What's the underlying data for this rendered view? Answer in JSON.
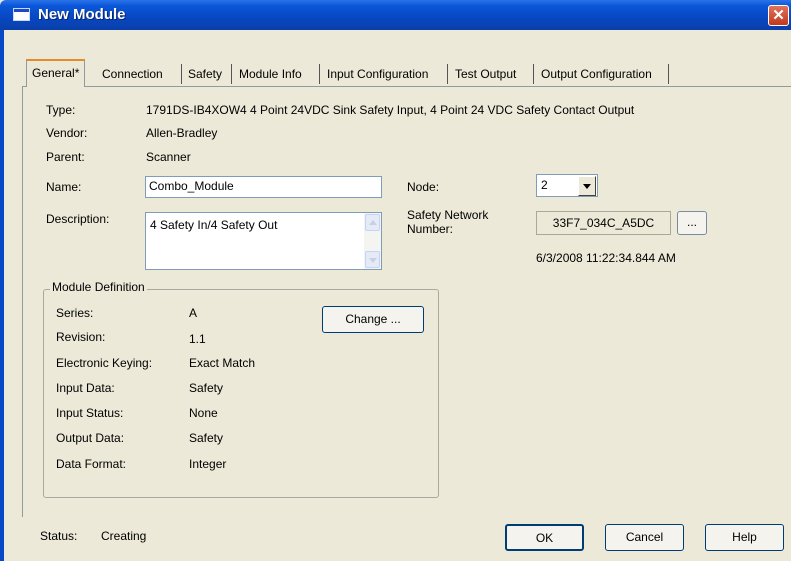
{
  "window": {
    "title": "New Module",
    "close_glyph": "✕"
  },
  "tabs": [
    {
      "label": "General*",
      "active": true
    },
    {
      "label": "Connection"
    },
    {
      "label": "Safety"
    },
    {
      "label": "Module Info"
    },
    {
      "label": "Input Configuration"
    },
    {
      "label": "Test Output"
    },
    {
      "label": "Output Configuration"
    }
  ],
  "general": {
    "type_label": "Type:",
    "type_value": "1791DS-IB4XOW4 4 Point 24VDC Sink Safety Input, 4 Point 24 VDC Safety Contact Output",
    "vendor_label": "Vendor:",
    "vendor_value": "Allen-Bradley",
    "parent_label": "Parent:",
    "parent_value": "Scanner",
    "name_label": "Name:",
    "name_value": "Combo_Module",
    "description_label": "Description:",
    "description_value": "4 Safety In/4 Safety Out",
    "node_label": "Node:",
    "node_value": "2",
    "safety_network_label_line1": "Safety Network",
    "safety_network_label_line2": "Number:",
    "safety_network_value": "33F7_034C_A5DC",
    "safety_network_browse": "...",
    "safety_network_timestamp": "6/3/2008 11:22:34.844 AM"
  },
  "module_definition": {
    "title": "Module Definition",
    "change_button": "Change ...",
    "rows": [
      {
        "label": "Series:",
        "value": "A"
      },
      {
        "label": "Revision:",
        "value": "1.1"
      },
      {
        "label": "Electronic Keying:",
        "value": "Exact Match"
      },
      {
        "label": "Input Data:",
        "value": "Safety"
      },
      {
        "label": "Input Status:",
        "value": "None"
      },
      {
        "label": "Output Data:",
        "value": "Safety"
      },
      {
        "label": "Data Format:",
        "value": "Integer"
      }
    ]
  },
  "footer": {
    "status_label": "Status:",
    "status_value": "Creating",
    "ok_button": "OK",
    "cancel_button": "Cancel",
    "help_button": "Help"
  },
  "colors": {
    "titlebar": "#0a56d8",
    "dialog_bg": "#ece9d8",
    "close_button": "#c2381e",
    "active_tab_accent": "#e68b2c"
  }
}
